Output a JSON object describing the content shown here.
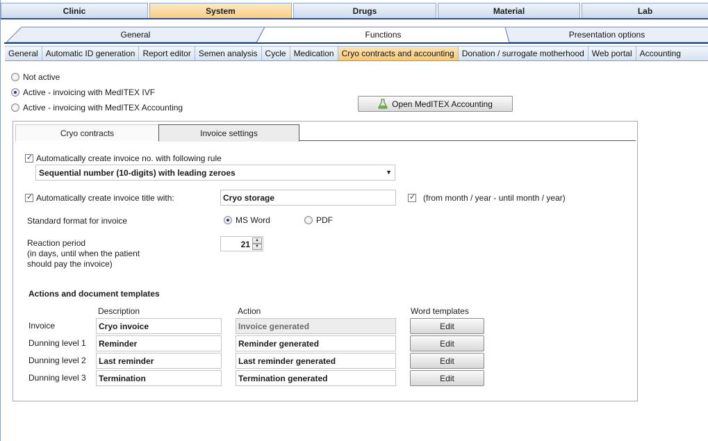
{
  "top_tabs": [
    {
      "label": "Clinic",
      "active": false
    },
    {
      "label": "System",
      "active": true
    },
    {
      "label": "Drugs",
      "active": false
    },
    {
      "label": "Material",
      "active": false
    },
    {
      "label": "Lab",
      "active": false
    }
  ],
  "section_tabs": [
    "General",
    "Functions",
    "Presentation options"
  ],
  "subnav": [
    "General",
    "Automatic ID generation",
    "Report editor",
    "Semen analysis",
    "Cycle",
    "Medication",
    "Cryo contracts and accounting",
    "Donation / surrogate motherhood",
    "Web portal",
    "Accounting"
  ],
  "subnav_active": "Cryo contracts and accounting",
  "mode": {
    "options": [
      "Not active",
      "Active - invoicing with MedITEX IVF",
      "Active - invoicing with MedITEX Accounting"
    ],
    "selected": "Active - invoicing with MedITEX IVF"
  },
  "open_button": "Open MedITEX Accounting",
  "inner_tabs": [
    "Cryo contracts",
    "Invoice settings"
  ],
  "inner_tab_active": "Invoice settings",
  "invoice_no": {
    "label": "Automatically create invoice no. with following rule",
    "checked": true,
    "rule": "Sequential number (10-digits) with leading zeroes"
  },
  "invoice_title": {
    "label": "Automatically create invoice title with:",
    "checked": true,
    "value": "Cryo storage",
    "period_label": "(from month / year - until month / year)",
    "period_checked": true
  },
  "format": {
    "label": "Standard format for invoice",
    "options": [
      "MS Word",
      "PDF"
    ],
    "selected": "MS Word"
  },
  "reaction": {
    "label_lines": [
      "Reaction period",
      "(in days, until when the patient",
      "should pay the invoice)"
    ],
    "value": "21"
  },
  "actions": {
    "heading": "Actions and document templates",
    "col_description": "Description",
    "col_action": "Action",
    "col_templates": "Word templates",
    "rows": [
      {
        "label": "Invoice",
        "description": "Cryo invoice",
        "action": "Invoice generated",
        "action_disabled": true,
        "button": "Edit"
      },
      {
        "label": "Dunning level 1",
        "description": "Reminder",
        "action": "Reminder generated",
        "action_disabled": false,
        "button": "Edit"
      },
      {
        "label": "Dunning level 2",
        "description": "Last reminder",
        "action": "Last reminder generated",
        "action_disabled": false,
        "button": "Edit"
      },
      {
        "label": "Dunning level 3",
        "description": "Termination",
        "action": "Termination generated",
        "action_disabled": false,
        "button": "Edit"
      }
    ]
  },
  "colors": {
    "accent_active": "#f9cf84",
    "tab_blue": "#cdd9ec",
    "border_dark": "#1d3c78"
  }
}
